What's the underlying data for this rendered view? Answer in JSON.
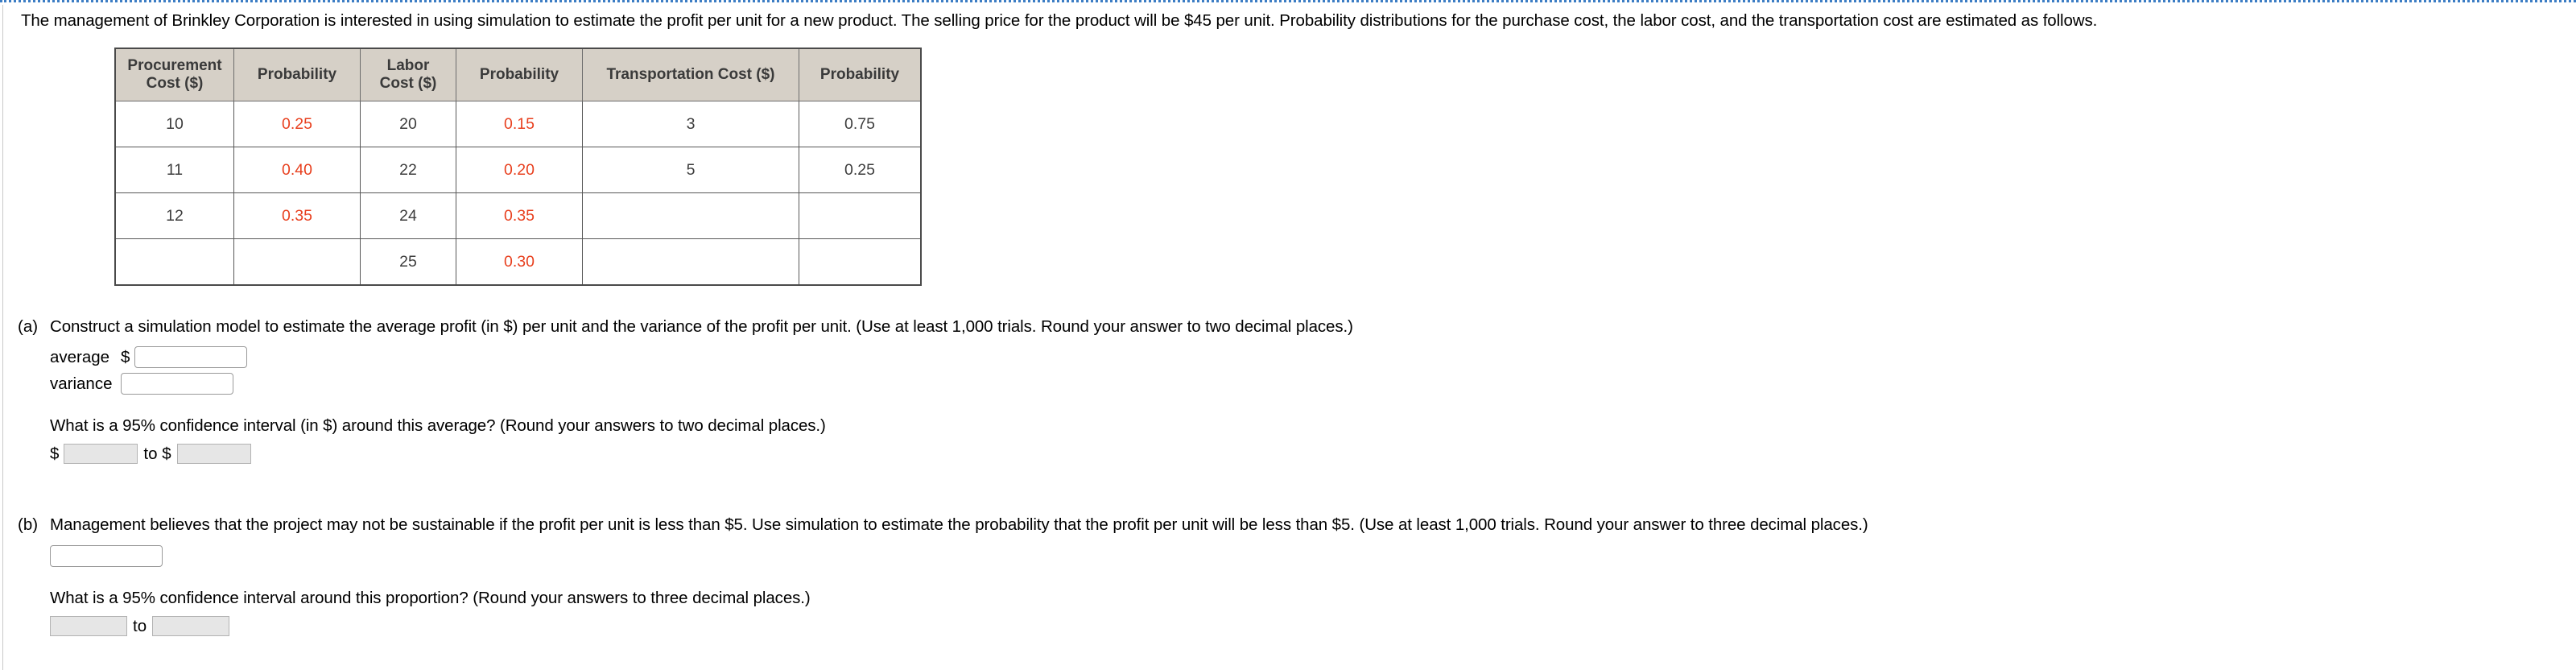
{
  "problem": {
    "intro": "The management of Brinkley Corporation is interested in using simulation to estimate the profit per unit for a new product. The selling price for the product will be $45 per unit. Probability distributions for the purchase cost, the labor cost, and the transportation cost are estimated as follows."
  },
  "table": {
    "headers": [
      "Procurement Cost ($)",
      "Probability",
      "Labor Cost ($)",
      "Probability",
      "Transportation Cost ($)",
      "Probability"
    ],
    "header_lines": [
      [
        "Procurement",
        "Cost ($)"
      ],
      [
        "Probability"
      ],
      [
        "Labor",
        "Cost ($)"
      ],
      [
        "Probability"
      ],
      [
        "Transportation Cost ($)"
      ],
      [
        "Probability"
      ]
    ],
    "rows": [
      [
        "10",
        "0.25",
        "20",
        "0.15",
        "3",
        "0.75"
      ],
      [
        "11",
        "0.40",
        "22",
        "0.20",
        "5",
        "0.25"
      ],
      [
        "12",
        "0.35",
        "24",
        "0.35",
        "",
        ""
      ],
      [
        "",
        "",
        "25",
        "0.30",
        "",
        ""
      ]
    ],
    "red_columns": [
      1,
      3
    ],
    "colors": {
      "header_bg": "#d6d0c7",
      "header_text": "#3a3a3a",
      "cell_text": "#3d3d3d",
      "highlight_text": "#e8401f",
      "border": "#585858"
    }
  },
  "part_a": {
    "label": "(a)",
    "prompt": "Construct a simulation model to estimate the average profit (in $) per unit and the variance of the profit per unit. (Use at least 1,000 trials. Round your answer to two decimal places.)",
    "average_label": "average",
    "average_currency": "$",
    "average_value": "",
    "variance_label": "variance",
    "variance_value": "",
    "ci_prompt": "What is a 95% confidence interval (in $) around this average? (Round your answers to two decimal places.)",
    "ci_currency_low": "$",
    "ci_low_value": "",
    "ci_separator": "to $",
    "ci_high_value": ""
  },
  "part_b": {
    "label": "(b)",
    "prompt": "Management believes that the project may not be sustainable if the profit per unit is less than $5. Use simulation to estimate the probability that the profit per unit will be less than $5. (Use at least 1,000 trials. Round your answer to three decimal places.)",
    "probability_value": "",
    "ci_prompt": "What is a 95% confidence interval around this proportion? (Round your answers to three decimal places.)",
    "ci_low_value": "",
    "ci_separator": "to",
    "ci_high_value": ""
  }
}
